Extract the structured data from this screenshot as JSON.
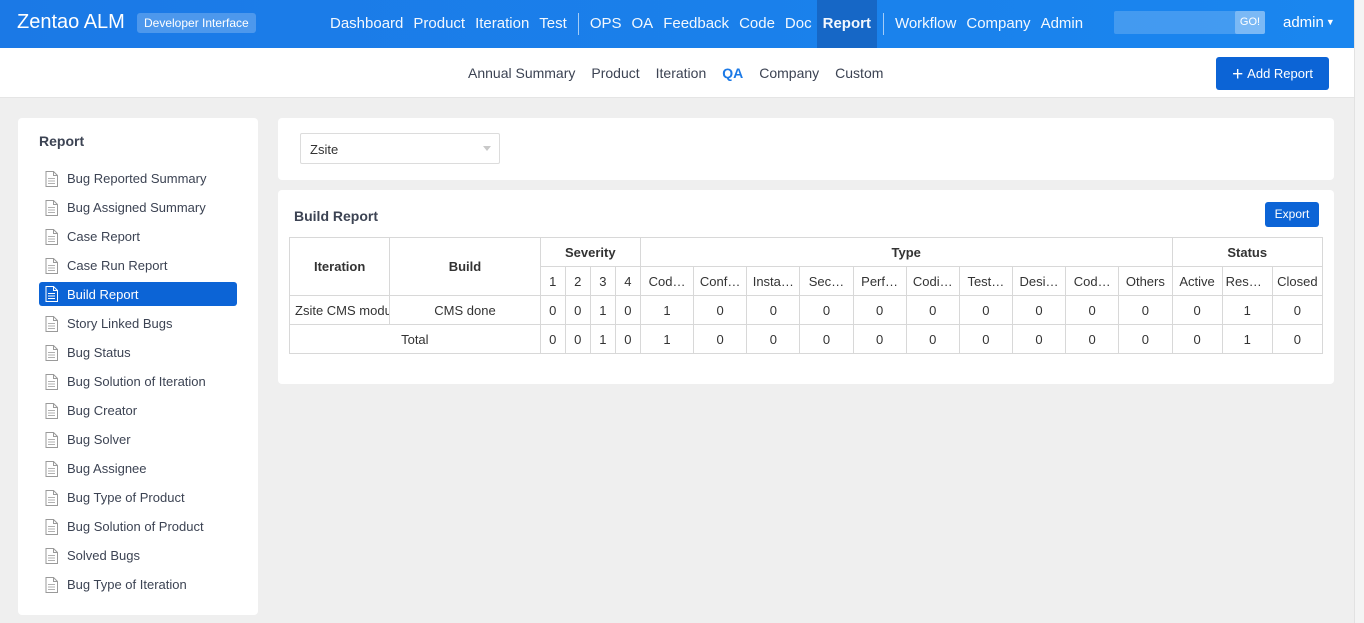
{
  "header": {
    "brand": "Zentao ALM",
    "badge": "Developer Interface",
    "nav": [
      {
        "label": "Dashboard"
      },
      {
        "label": "Product"
      },
      {
        "label": "Iteration"
      },
      {
        "label": "Test"
      },
      {
        "label": "OPS"
      },
      {
        "label": "OA"
      },
      {
        "label": "Feedback"
      },
      {
        "label": "Code"
      },
      {
        "label": "Doc"
      },
      {
        "label": "Report"
      },
      {
        "label": "Workflow"
      },
      {
        "label": "Company"
      },
      {
        "label": "Admin"
      }
    ],
    "search_placeholder": "",
    "go_label": "GO!",
    "user": "admin"
  },
  "subnav": {
    "items": [
      {
        "label": "Annual Summary"
      },
      {
        "label": "Product"
      },
      {
        "label": "Iteration"
      },
      {
        "label": "QA"
      },
      {
        "label": "Company"
      },
      {
        "label": "Custom"
      }
    ],
    "add_report": "Add Report"
  },
  "sidebar": {
    "title": "Report",
    "items": [
      {
        "label": "Bug Reported Summary"
      },
      {
        "label": "Bug Assigned Summary"
      },
      {
        "label": "Case Report"
      },
      {
        "label": "Case Run Report"
      },
      {
        "label": "Build Report"
      },
      {
        "label": "Story Linked Bugs"
      },
      {
        "label": "Bug Status"
      },
      {
        "label": "Bug Solution of Iteration"
      },
      {
        "label": "Bug Creator"
      },
      {
        "label": "Bug Solver"
      },
      {
        "label": "Bug Assignee"
      },
      {
        "label": "Bug Type of Product"
      },
      {
        "label": "Bug Solution of Product"
      },
      {
        "label": "Solved Bugs"
      },
      {
        "label": "Bug Type of Iteration"
      }
    ]
  },
  "filter": {
    "product": "Zsite"
  },
  "report": {
    "title": "Build Report",
    "export": "Export",
    "headers": {
      "iteration": "Iteration",
      "build": "Build",
      "severity": "Severity",
      "type": "Type",
      "status": "Status",
      "severity_levels": [
        "1",
        "2",
        "3",
        "4"
      ],
      "types": [
        "Cod…",
        "Conf…",
        "Insta…",
        "Sec…",
        "Perf…",
        "Codi…",
        "Test…",
        "Desi…",
        "Cod…",
        "Others"
      ],
      "statuses": [
        "Active",
        "Resolve",
        "Closed"
      ]
    },
    "rows": [
      {
        "iteration": "Zsite CMS modu",
        "build": "CMS done",
        "cells": [
          "0",
          "0",
          "1",
          "0",
          "1",
          "0",
          "0",
          "0",
          "0",
          "0",
          "0",
          "0",
          "0",
          "0",
          "0",
          "1",
          "0"
        ]
      }
    ],
    "total": {
      "label": "Total",
      "cells": [
        "0",
        "0",
        "1",
        "0",
        "1",
        "0",
        "0",
        "0",
        "0",
        "0",
        "0",
        "0",
        "0",
        "0",
        "0",
        "1",
        "0"
      ]
    }
  }
}
